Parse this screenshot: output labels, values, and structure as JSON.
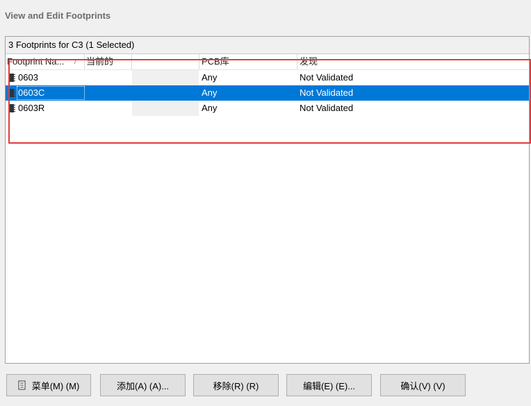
{
  "section_title": "View and Edit Footprints",
  "panel_header": "3 Footprints for C3 (1 Selected)",
  "columns": [
    "Footprint Na...",
    "当前的",
    "",
    "PCB库",
    "发现"
  ],
  "sort_indicator": "/",
  "rows": [
    {
      "name": "0603",
      "current": "",
      "pcb_library": "Any",
      "found": "Not Validated",
      "selected": false
    },
    {
      "name": "0603C",
      "current": "",
      "pcb_library": "Any",
      "found": "Not Validated",
      "selected": true
    },
    {
      "name": "0603R",
      "current": "",
      "pcb_library": "Any",
      "found": "Not Validated",
      "selected": false
    }
  ],
  "buttons": {
    "menu": "菜单(M) (M)",
    "add": "添加(A) (A)...",
    "remove": "移除(R) (R)",
    "edit": "编辑(E) (E)...",
    "ok": "确认(V) (V)"
  },
  "colors": {
    "selection": "#0078d7",
    "highlight_border": "#e03c3c",
    "panel_background": "#ffffff",
    "window_background": "#f0f0f0"
  },
  "icons": {
    "row_icon": "footprint-chip-icon",
    "menu_icon": "menu-document-icon"
  }
}
